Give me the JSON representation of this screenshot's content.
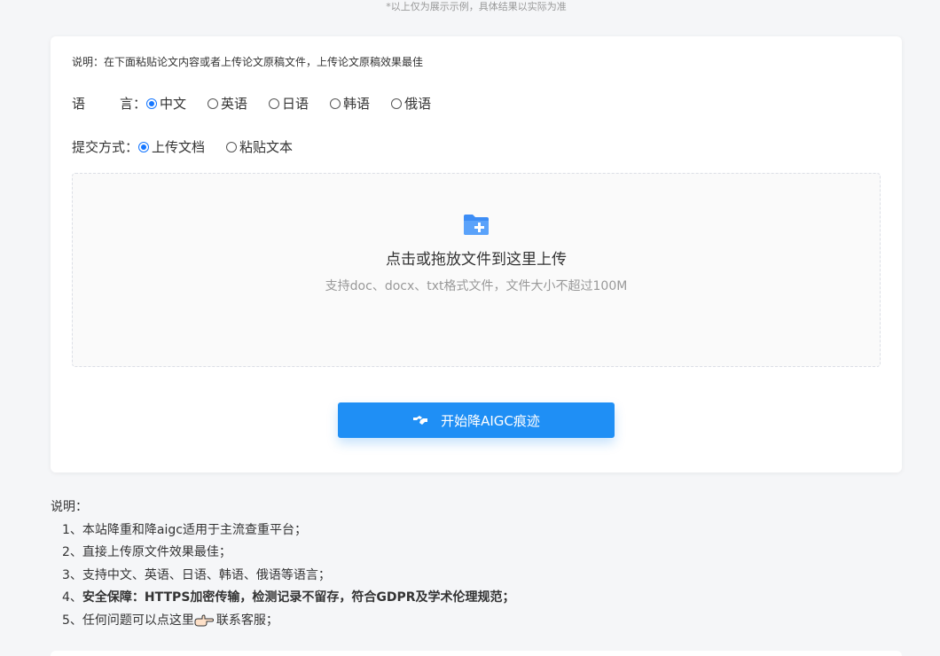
{
  "top_note": "*以上仅为展示示例，具体结果以实际为准",
  "form": {
    "hint": "说明：在下面粘贴论文内容或者上传论文原稿文件，上传论文原稿效果最佳",
    "language": {
      "label_a": "语",
      "label_b": "言：",
      "options": [
        "中文",
        "英语",
        "日语",
        "韩语",
        "俄语"
      ],
      "selected": "中文"
    },
    "submit_mode": {
      "label": "提交方式：",
      "options": [
        "上传文档",
        "粘贴文本"
      ],
      "selected": "上传文档"
    },
    "upload": {
      "icon": "folder-plus-icon",
      "title": "点击或拖放文件到这里上传",
      "subtitle": "支持doc、docx、txt格式文件，文件大小不超过100M"
    },
    "start_button": {
      "icon": "handshake-icon",
      "label": "开始降AIGC痕迹"
    }
  },
  "notes": {
    "heading": "说明：",
    "items": [
      "1、本站降重和降aigc适用于主流查重平台；",
      "2、直接上传原文件效果最佳；",
      "3、支持中文、英语、日语、韩语、俄语等语言；",
      "4、",
      "5、任何问题可以点这里"
    ],
    "item4_bold": "安全保障：HTTPS加密传输，检测记录不留存，符合GDPR及学术伦理规范；",
    "item5_icon": "pointing-hand-icon",
    "item5_link": "联系客服；"
  },
  "colors": {
    "accent": "#1f8ff5",
    "radio_selected": "#1677ff",
    "background": "#f5f6f8"
  }
}
